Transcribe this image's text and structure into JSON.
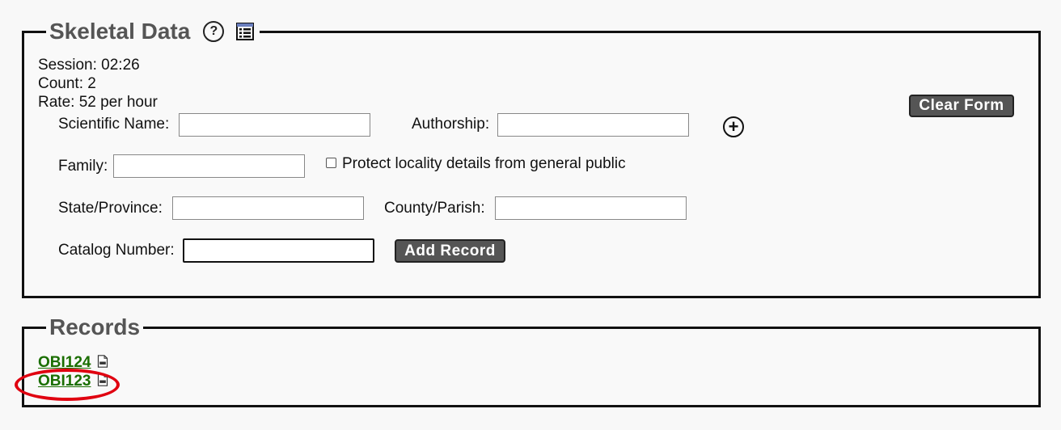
{
  "skeletal_panel": {
    "title": "Skeletal Data",
    "help_icon": "question-circle-icon",
    "list_icon": "table-list-icon"
  },
  "stats": {
    "session": "Session: 02:26",
    "count": "Count: 2",
    "rate": "Rate: 52 per hour"
  },
  "form": {
    "scientific_name_label": "Scientific Name:",
    "scientific_name_value": "",
    "authorship_label": "Authorship:",
    "authorship_value": "",
    "add_name_icon": "plus-circle-icon",
    "family_label": "Family:",
    "family_value": "",
    "protect_locality_label": "Protect locality details from general public",
    "protect_locality_checked": false,
    "state_label": "State/Province:",
    "state_value": "",
    "county_label": "County/Parish:",
    "county_value": "",
    "catalog_label": "Catalog Number:",
    "catalog_value": "",
    "add_record_button": "Add Record",
    "clear_form_button": "Clear Form"
  },
  "records_panel": {
    "title": "Records",
    "items": [
      {
        "id": "OBI124",
        "icon": "pdf-document-icon"
      },
      {
        "id": "OBI123",
        "icon": "pdf-document-icon"
      }
    ],
    "highlight_color": "#e00010"
  },
  "colors": {
    "button_bg": "#555555",
    "link": "#1a6e00",
    "legend": "#555555"
  }
}
